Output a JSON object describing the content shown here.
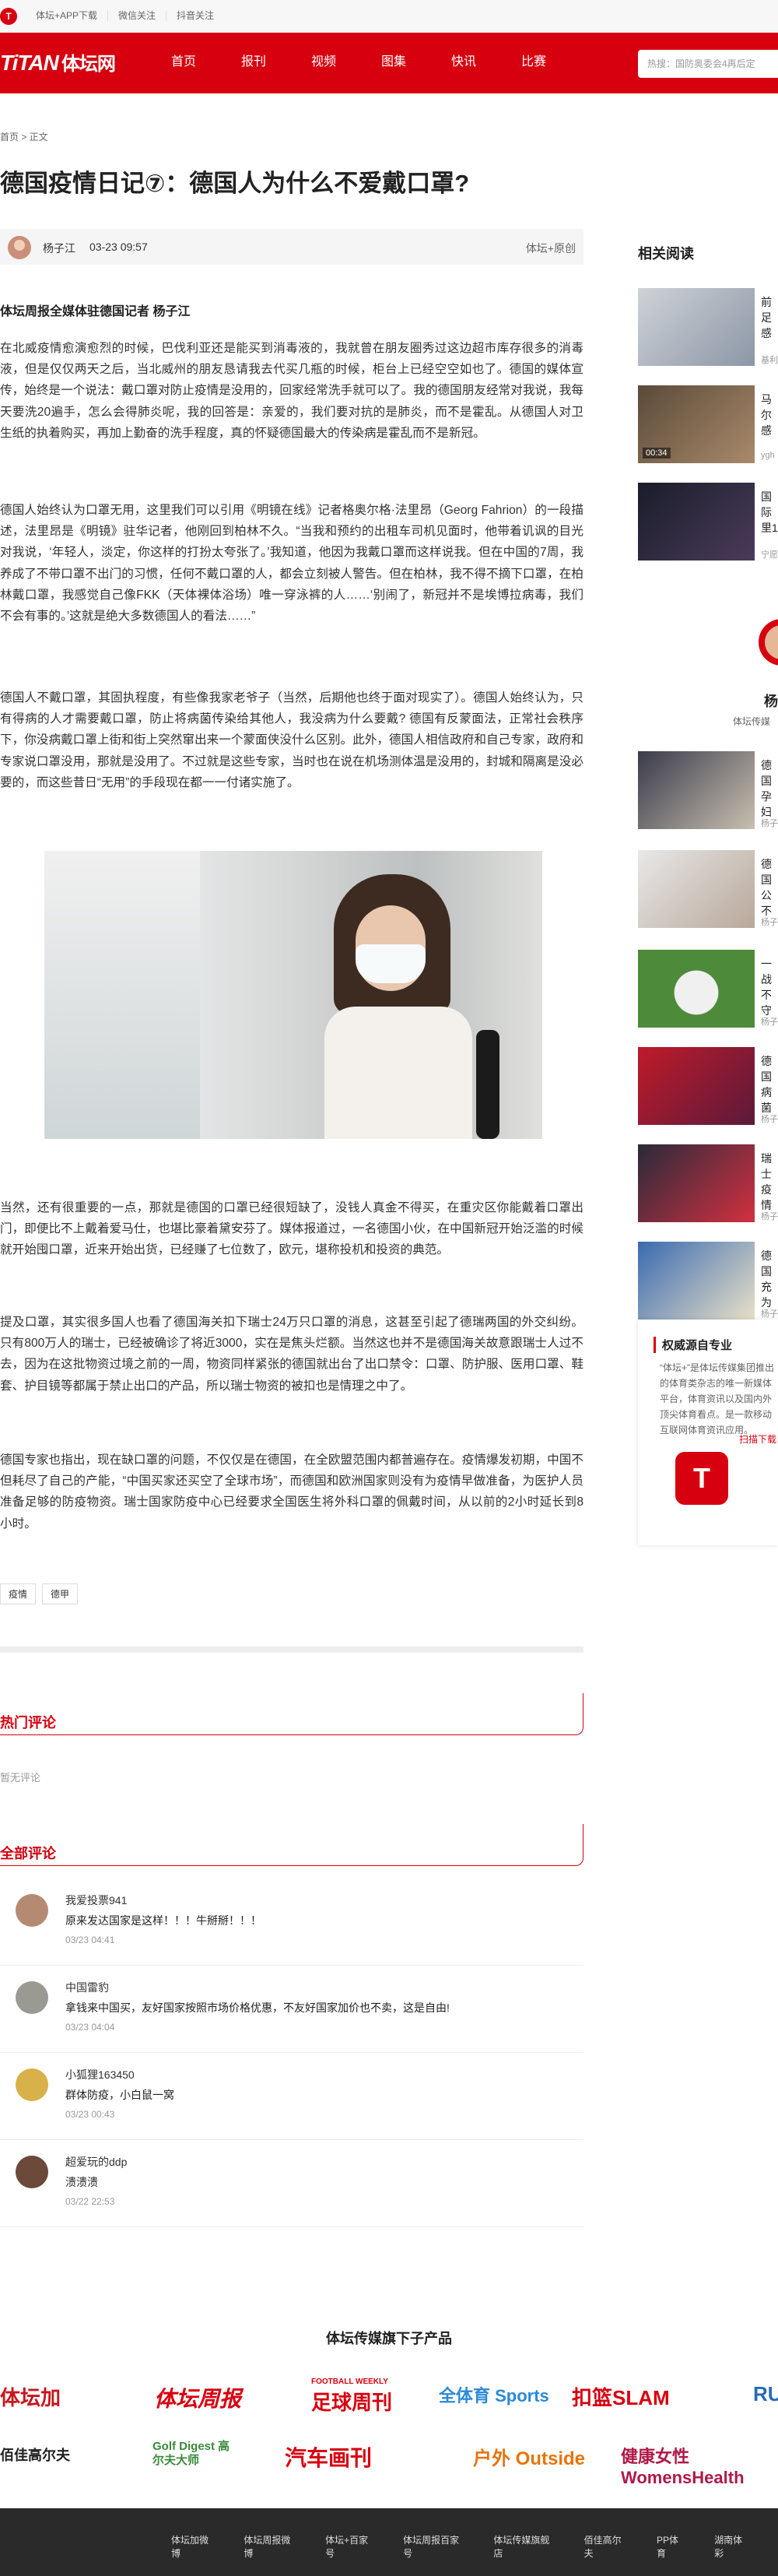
{
  "topbar": {
    "logo_glyph": "T",
    "links": [
      "体坛+APP下载",
      "微信关注",
      "抖音关注"
    ]
  },
  "header": {
    "logo_latin": "TiTAN",
    "logo_cn": "体坛网",
    "menu": [
      "首页",
      "报刊",
      "视频",
      "图集",
      "快讯",
      "比赛"
    ],
    "search_placeholder": "热搜：国防奥委会4再后定"
  },
  "breadcrumb": "首页 > 正文",
  "article": {
    "title": "德国疫情日记⑦：德国人为什么不爱戴口罩?",
    "author": "杨子江",
    "date": "03-23 09:57",
    "source": "体坛+原创",
    "byline": "体坛周报全媒体驻德国记者 杨子江",
    "paragraphs": [
      "在北威疫情愈演愈烈的时候，巴伐利亚还是能买到消毒液的，我就曾在朋友圈秀过这边超市库存很多的消毒液，但是仅仅两天之后，当北威州的朋友恳请我去代买几瓶的时候，柜台上已经空空如也了。德国的媒体宣传，始终是一个说法：戴口罩对防止疫情是没用的，回家经常洗手就可以了。我的德国朋友经常对我说，我每天要洗20遍手，怎么会得肺炎呢，我的回答是：亲爱的，我们要对抗的是肺炎，而不是霍乱。从德国人对卫生纸的执着购买，再加上勤奋的洗手程度，真的怀疑德国最大的传染病是霍乱而不是新冠。",
      "德国人始终认为口罩无用，这里我们可以引用《明镜在线》记者格奥尔格·法里昂（Georg Fahrion）的一段描述，法里昂是《明镜》驻华记者，他刚回到柏林不久。“当我和预约的出租车司机见面时，他带着讥讽的目光对我说，‘年轻人，淡定，你这样的打扮太夸张了。’我知道，他因为我戴口罩而这样说我。但在中国的7周，我养成了不带口罩不出门的习惯，任何不戴口罩的人，都会立刻被人警告。但在柏林，我不得不摘下口罩，在柏林戴口罩，我感觉自己像FKK（天体裸体浴场）唯一穿泳裤的人……‘别闹了，新冠并不是埃博拉病毒，我们不会有事的。’这就是绝大多数德国人的看法……”",
      "德国人不戴口罩，其固执程度，有些像我家老爷子（当然，后期他也终于面对现实了）。德国人始终认为，只有得病的人才需要戴口罩，防止将病菌传染给其他人，我没病为什么要戴? 德国有反蒙面法，正常社会秩序下，你没病戴口罩上街和街上突然窜出来一个蒙面侠没什么区别。此外，德国人相信政府和自己专家，政府和专家说口罩没用，那就是没用了。不过就是这些专家，当时也在说在机场测体温是没用的，封城和隔离是没必要的，而这些昔日“无用”的手段现在都一一付诸实施了。",
      "当然，还有很重要的一点，那就是德国的口罩已经很短缺了，没钱人真金不得买，在重灾区你能戴着口罩出门，即便比不上戴着爱马仕，也堪比豪着黛安芬了。媒体报道过，一名德国小伙，在中国新冠开始泛滥的时候就开始囤口罩，近来开始出货，已经赚了七位数了，欧元，堪称投机和投资的典范。",
      "提及口罩，其实很多国人也看了德国海关扣下瑞士24万只口罩的消息，这甚至引起了德瑞两国的外交纠纷。只有800万人的瑞士，已经被确诊了将近3000，实在是焦头烂额。当然这也并不是德国海关故意跟瑞士人过不去，因为在这批物资过境之前的一周，物资同样紧张的德国就出台了出口禁令：口罩、防护服、医用口罩、鞋套、护目镜等都属于禁止出口的产品，所以瑞士物资的被扣也是情理之中了。",
      "德国专家也指出，现在缺口罩的问题，不仅仅是在德国，在全欧盟范围内都普遍存在。疫情爆发初期，中国不但耗尽了自己的产能，“中国买家还买空了全球市场”，而德国和欧洲国家则没有为疫情早做准备，为医护人员准备足够的防疫物资。瑞士国家防疫中心已经要求全国医生将外科口罩的佩戴时间，从以前的2小时延长到8小时。"
    ],
    "tags": [
      "疫情",
      "德甲"
    ]
  },
  "hot_comments": {
    "title": "热门评论",
    "empty": "暂无评论"
  },
  "all_comments": {
    "title": "全部评论",
    "items": [
      {
        "user": "我爱投票941",
        "text": "原来发达国家是这样！！！牛掰掰！！！",
        "date": "03/23 04:41"
      },
      {
        "user": "中国雷豹",
        "text": "拿钱来中国买，友好国家按照市场价格优惠，不友好国家加价也不卖，这是自由!",
        "date": "03/23 04:04"
      },
      {
        "user": "小狐狸163450",
        "text": "群体防疫，小白鼠一窝",
        "date": "03/23 00:43"
      },
      {
        "user": "超爱玩的ddp",
        "text": "溃溃溃",
        "date": "03/22 22:53"
      }
    ]
  },
  "sidebar": {
    "title": "相关阅读",
    "related": [
      {
        "title": "前足感",
        "source": "基利"
      },
      {
        "title": "马尔感",
        "source": "ygh",
        "duration": "00:34"
      },
      {
        "title": "国际里1",
        "source": "宁愿"
      }
    ],
    "profile": {
      "name": "杨",
      "desc": "体坛传媒"
    },
    "items": [
      {
        "title": "德国孕妇",
        "source": "杨子"
      },
      {
        "title": "德国公不",
        "source": "杨子"
      },
      {
        "title": "一战不守",
        "source": "杨子"
      },
      {
        "title": "德国病菌",
        "source": "杨子"
      },
      {
        "title": "瑞士疫情",
        "source": "杨子"
      },
      {
        "title": "德国充为",
        "source": "杨子"
      }
    ],
    "auth": {
      "title": "权威源自专业",
      "desc": "“体坛+”是体坛传媒集团推出的体育类杂志的唯一新媒体平台，体育资讯以及国内外顶尖体育看点。是一款移动互联网体育资讯应用。",
      "download": "扫描下载",
      "app_glyph": "T"
    }
  },
  "products": {
    "title": "体坛传媒旗下子产品",
    "row1": [
      "体坛加",
      "体坛周报",
      "足球周刊",
      "全体育 Sports",
      "扣篮SLAM",
      "RU"
    ],
    "row2": [
      "佰佳高尔夫",
      "Golf Digest 高尔夫大师",
      "汽车画刊",
      "户外 Outside",
      "健康女性 WomensHealth"
    ],
    "row1_sub": "FOOTBALL WEEKLY"
  },
  "footer": {
    "links": [
      "体坛加微博",
      "体坛周报微博",
      "体坛+百家号",
      "体坛周报百家号",
      "体坛传媒旗舰店",
      "佰佳高尔夫",
      "PP体育",
      "湖南体彩"
    ]
  },
  "colors": {
    "brand": "#d7000f",
    "text": "#333333",
    "muted": "#999999"
  }
}
